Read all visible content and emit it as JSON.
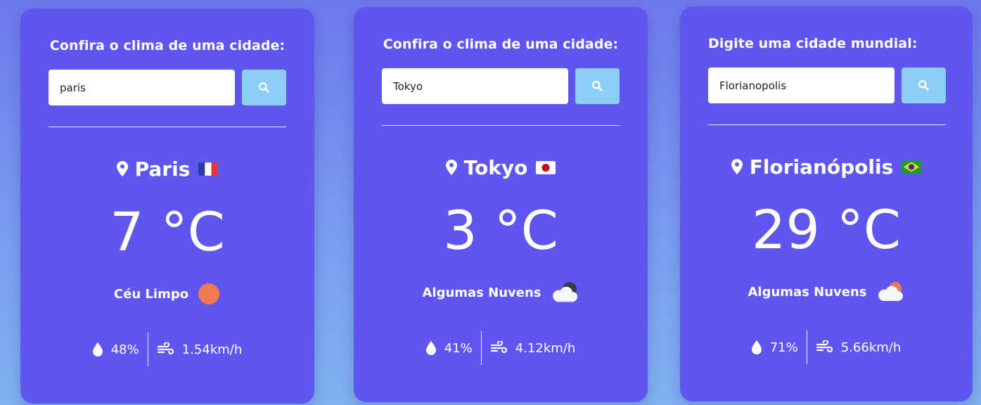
{
  "cards": [
    {
      "title": "Confira o clima de uma cidade:",
      "search_value": "paris",
      "city": "Paris",
      "flag": "france-flag",
      "temperature": "7 °C",
      "condition": "Céu Limpo",
      "condition_icon": "sun-icon",
      "humidity": "48%",
      "wind": "1.54km/h"
    },
    {
      "title": "Confira o clima de uma cidade:",
      "search_value": "Tokyo",
      "city": "Tokyo",
      "flag": "japan-flag",
      "temperature": "3 °C",
      "condition": "Algumas Nuvens",
      "condition_icon": "cloud-moon-icon",
      "humidity": "41%",
      "wind": "4.12km/h"
    },
    {
      "title": "Digite uma cidade mundial:",
      "search_value": "Florianopolis",
      "city": "Florianópolis",
      "flag": "brazil-flag",
      "temperature": "29 °C",
      "condition": "Algumas Nuvens",
      "condition_icon": "cloud-sun-icon",
      "humidity": "71%",
      "wind": "5.66km/h"
    }
  ],
  "colors": {
    "card_background": "#5e56ef",
    "search_button": "#8ecdf6",
    "sun": "#ef7a4f"
  }
}
